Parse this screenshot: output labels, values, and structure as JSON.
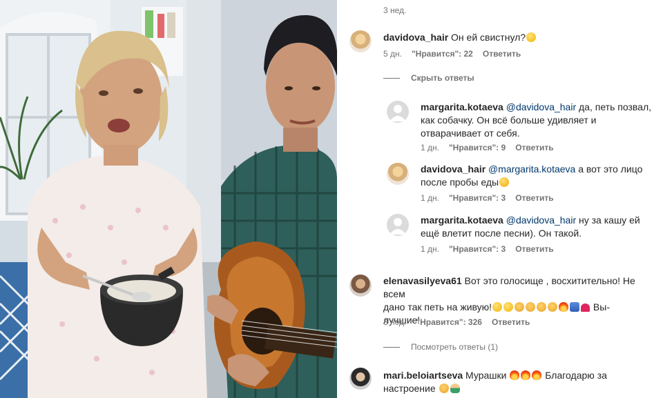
{
  "top_timestamp": "3 нед.",
  "comments": [
    {
      "username": "davidova_hair",
      "text": "Он ей свистнул?",
      "emoji": [
        "astonished-face"
      ],
      "time": "5 дн.",
      "likes": "\"Нравится\": 22",
      "reply": "Ответить",
      "toggle": "Скрыть ответы",
      "replies": [
        {
          "username": "margarita.kotaeva",
          "mention": "@davidova_hair",
          "line1": " да, петь позвал,",
          "line2": "как собачку. Он всё больше удивляет и",
          "line3": "отварачивает от себя.",
          "time": "1 дн.",
          "likes": "\"Нравится\": 9",
          "reply": "Ответить"
        },
        {
          "username": "davidova_hair",
          "mention": "@margarita.kotaeva",
          "line1": " а вот это лицо",
          "line2": "после пробы еды",
          "emoji": [
            "face-with-hand"
          ],
          "time": "1 дн.",
          "likes": "\"Нравится\": 3",
          "reply": "Ответить"
        },
        {
          "username": "margarita.kotaeva",
          "mention": "@davidova_hair",
          "line1": " ну за кашу ей",
          "line2": "ещё влетит после песни). Он такой.",
          "time": "1 дн.",
          "likes": "\"Нравится\": 3",
          "reply": "Ответить"
        }
      ]
    },
    {
      "username": "elenavasilyeva61",
      "line1": " Вот это голосище , восхитительно! Не всем",
      "line2a": "дано так петь на живую!",
      "line2b": " Вы-",
      "line3": "лучшие!",
      "emoji": [
        "astonished-face",
        "heart-eyes-face",
        "clapping-hands",
        "clapping-hands",
        "clapping-hands",
        "clapping-hands",
        "fire",
        "raising-hands",
        "red-heart"
      ],
      "time": "3 нед.",
      "likes": "\"Нравится\": 326",
      "reply": "Ответить",
      "toggle": "Посмотреть ответы (1)"
    },
    {
      "username": "mari.beloiartseva",
      "line1": " Мурашки ",
      "line1b": " Благодарю за",
      "line2": "настроение ",
      "emoji_a": [
        "fire",
        "fire",
        "fire"
      ],
      "emoji_b": [
        "clapping-hands",
        "person-bowing"
      ]
    }
  ],
  "colors": {
    "text": "#262626",
    "secondary": "#737373",
    "mention": "#00376b",
    "background": "#ffffff"
  }
}
